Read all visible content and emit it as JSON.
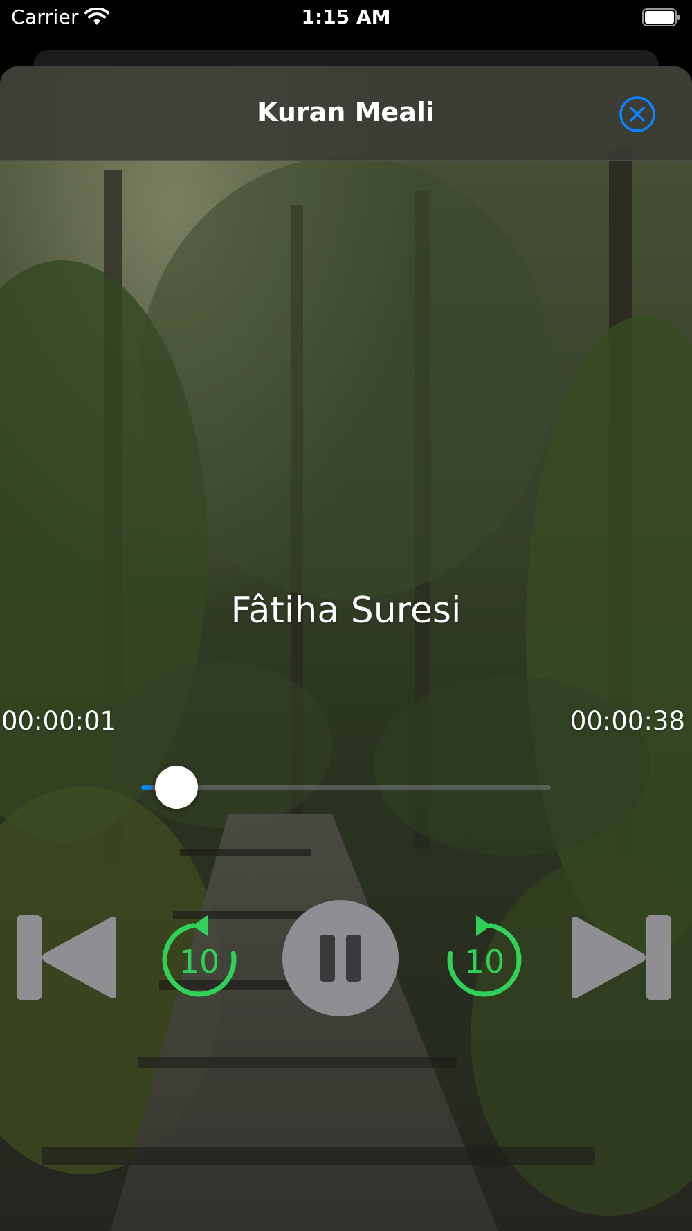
{
  "status_bar": {
    "carrier": "Carrier",
    "time": "1:15 AM"
  },
  "nav": {
    "title": "Kuran Meali",
    "close_icon": "close-circle-icon"
  },
  "player": {
    "track_title": "Fâtiha Suresi",
    "elapsed": "00:00:01",
    "total": "00:00:38",
    "progress_fraction": 0.026,
    "skip_back_seconds": "10",
    "skip_forward_seconds": "10",
    "state": "playing"
  },
  "colors": {
    "accent_blue": "#0a84ff",
    "skip_green": "#30d158",
    "control_gray": "#8e8e93"
  },
  "icons": {
    "previous": "backward-end-icon",
    "rewind": "gobackward-10-icon",
    "pause": "pause-circle-icon",
    "forward": "goforward-10-icon",
    "next": "forward-end-icon"
  }
}
